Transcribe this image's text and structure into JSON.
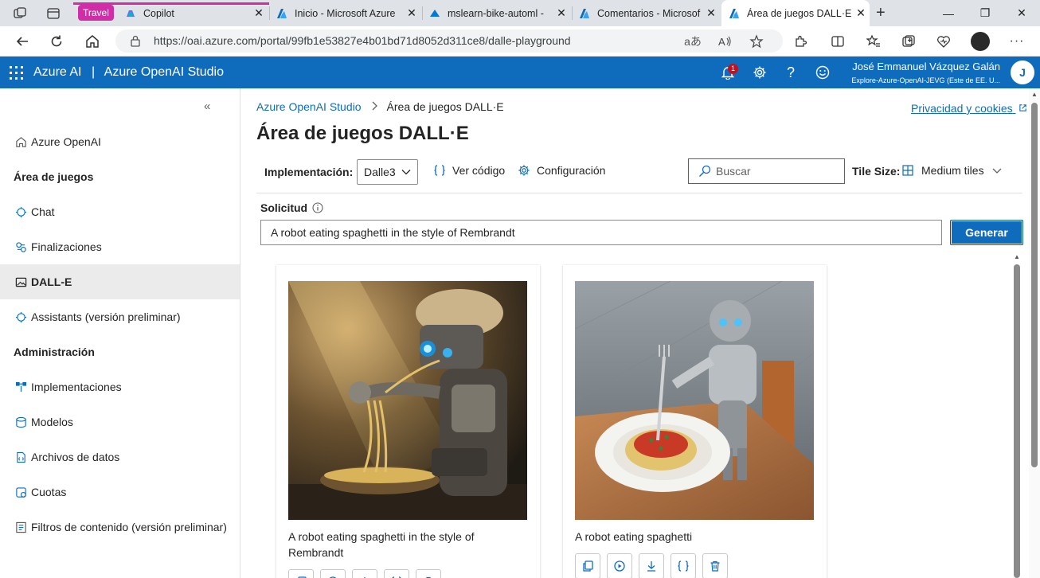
{
  "browser": {
    "tabs": [
      {
        "label": "Copilot"
      },
      {
        "label": "Inicio - Microsoft Azure"
      },
      {
        "label": "mslearn-bike-automl -"
      },
      {
        "label": "Comentarios - Microsof"
      },
      {
        "label": "Área de juegos DALL·E"
      }
    ],
    "travel_label": "Travel",
    "url": "https://oai.azure.com/portal/99fb1e53827e4b01bd71d8052d311ce8/dalle-playground",
    "url_reader_glyph": "aあ"
  },
  "header": {
    "brand": "Azure AI",
    "separator": "|",
    "product": "Azure OpenAI Studio",
    "notification_count": "1",
    "user_name": "José Emmanuel Vázquez Galán",
    "user_subtitle": "Explore-Azure-OpenAI-JEVG (Este de EE. U...",
    "avatar_initial": "J",
    "accent": "#0f6cbd"
  },
  "sidebar": {
    "collapse_glyph": "«",
    "items": [
      {
        "label": "Azure OpenAI"
      },
      {
        "label": "Área de juegos"
      },
      {
        "label": "Chat"
      },
      {
        "label": "Finalizaciones"
      },
      {
        "label": "DALL-E"
      },
      {
        "label": "Assistants (versión preliminar)"
      },
      {
        "label": "Administración"
      },
      {
        "label": "Implementaciones"
      },
      {
        "label": "Modelos"
      },
      {
        "label": "Archivos de datos"
      },
      {
        "label": "Cuotas"
      },
      {
        "label": "Filtros de contenido (versión preliminar)"
      }
    ]
  },
  "breadcrumb": {
    "root": "Azure OpenAI Studio",
    "current": "Área de juegos DALL·E"
  },
  "privacy_link": "Privacidad y cookies",
  "page_title": "Área de juegos DALL·E",
  "toolbar": {
    "deployment_label": "Implementación:",
    "deployment_value": "Dalle3",
    "view_code": "Ver código",
    "settings": "Configuración",
    "search_placeholder": "Buscar",
    "tile_size_label": "Tile Size:",
    "tile_size_value": "Medium tiles"
  },
  "prompt": {
    "label": "Solicitud",
    "value": "A robot eating spaghetti in the style of Rembrandt",
    "generate": "Generar"
  },
  "results": [
    {
      "caption": "A robot eating spaghetti in the style of Rembrandt"
    },
    {
      "caption": "A robot eating spaghetti"
    }
  ]
}
